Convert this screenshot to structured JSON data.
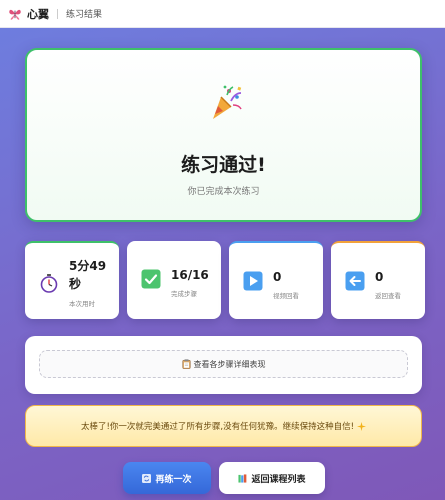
{
  "header": {
    "brand": "心翼",
    "breadcrumb": "练习结果",
    "logo_icon": "butterfly-icon"
  },
  "result": {
    "icon": "party-popper-icon",
    "title": "练习通过!",
    "subtitle": "你已完成本次练习",
    "accent_color": "#3ec06a"
  },
  "stats": [
    {
      "icon": "stopwatch-icon",
      "value": "5分49秒",
      "label": "本次用时"
    },
    {
      "icon": "check-icon",
      "value": "16/16",
      "label": "完成步骤"
    },
    {
      "icon": "play-icon",
      "value": "0",
      "label": "视频回看"
    },
    {
      "icon": "back-arrow-icon",
      "value": "0",
      "label": "返回查看"
    }
  ],
  "detail": {
    "icon": "clipboard-icon",
    "label": "查看各步骤详细表现"
  },
  "message": {
    "text": "太棒了!你一次就完美通过了所有步骤,没有任何犹豫。继续保持这种自信!",
    "icon": "sparkle-icon"
  },
  "actions": {
    "retry_label": "再练一次",
    "retry_icon": "repeat-icon",
    "back_label": "返回课程列表",
    "back_icon": "books-icon"
  }
}
